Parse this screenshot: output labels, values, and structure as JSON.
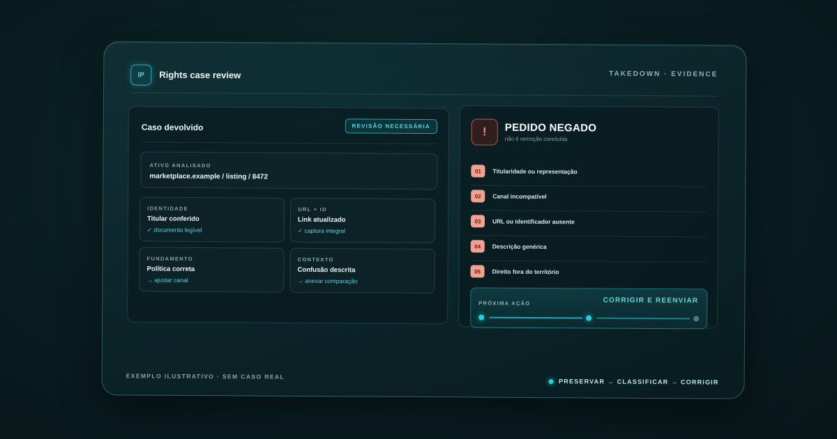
{
  "header": {
    "logo_text": "IP",
    "title": "Rights case review",
    "top_right_label": "TAKEDOWN · EVIDENCE"
  },
  "case": {
    "title": "Caso devolvido",
    "badge": "REVISÃO NECESSÁRIA",
    "asset": {
      "label": "ATIVO ANALISADO",
      "value": "marketplace.example / listing / 8472"
    },
    "cards": [
      {
        "label": "IDENTIDADE",
        "value": "Titular conferido",
        "note": "✓ documento legível"
      },
      {
        "label": "URL + ID",
        "value": "Link atualizado",
        "note": "✓ captura integral"
      },
      {
        "label": "FUNDAMENTO",
        "value": "Política correta",
        "note": "→ ajustar canal"
      },
      {
        "label": "CONTEXTO",
        "value": "Confusão descrita",
        "note": "→ anexar comparação"
      }
    ]
  },
  "denial": {
    "icon": "!",
    "icon_name": "alert-icon",
    "title": "PEDIDO NEGADO",
    "subtitle": "não é remoção concluída",
    "reasons": [
      {
        "num": "01",
        "text": "Titularidade ou representação"
      },
      {
        "num": "02",
        "text": "Canal incompatível"
      },
      {
        "num": "03",
        "text": "URL ou identificador ausente"
      },
      {
        "num": "04",
        "text": "Descrição genérica"
      },
      {
        "num": "05",
        "text": "Direito fora do território"
      }
    ],
    "next": {
      "label": "PRÓXIMA AÇÃO",
      "action": "CORRIGIR E REENVIAR",
      "steps_completed": 2,
      "steps_total": 3
    }
  },
  "footer": {
    "left": "EXEMPLO ILUSTRATIVO · SEM CASO REAL",
    "flow": "PRESERVAR → CLASSIFICAR → CORRIGIR"
  },
  "colors": {
    "accent": "#22d0dc",
    "danger_badge": "#f2a08f",
    "background": "#0a2024"
  }
}
